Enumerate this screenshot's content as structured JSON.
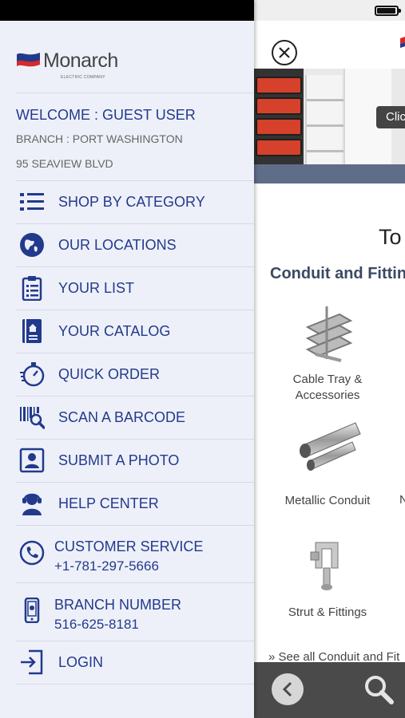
{
  "drawer": {
    "logo_text": "Monarch",
    "logo_subtext": "ELECTRIC COMPANY",
    "welcome": "WELCOME : GUEST USER",
    "branch": "BRANCH : PORT WASHINGTON",
    "address": "95 SEAVIEW BLVD",
    "menu": [
      {
        "label": "SHOP BY CATEGORY",
        "icon": "list-icon"
      },
      {
        "label": "OUR LOCATIONS",
        "icon": "location-globe-icon"
      },
      {
        "label": "YOUR LIST",
        "icon": "clipboard-list-icon"
      },
      {
        "label": "YOUR CATALOG",
        "icon": "catalog-book-icon"
      },
      {
        "label": "QUICK ORDER",
        "icon": "stopwatch-icon"
      },
      {
        "label": "SCAN A BARCODE",
        "icon": "barcode-scan-icon"
      },
      {
        "label": "SUBMIT A PHOTO",
        "icon": "photo-portrait-icon"
      },
      {
        "label": "HELP CENTER",
        "icon": "headset-agent-icon"
      },
      {
        "label": "CUSTOMER SERVICE",
        "sub": "+1-781-297-5666",
        "icon": "phone-icon"
      },
      {
        "label": "BRANCH NUMBER",
        "sub": "516-625-8181",
        "icon": "mobile-phone-icon"
      },
      {
        "label": "LOGIN",
        "icon": "login-arrow-icon"
      }
    ]
  },
  "app": {
    "banner_button": "Click",
    "section_title": "To",
    "section_subtitle": "Conduit and Fittin",
    "products": [
      {
        "name": "Cable Tray &\nAccessories"
      },
      {
        "name": "Metallic Conduit"
      },
      {
        "name": "Strut & Fittings"
      }
    ],
    "product_fragment": "N",
    "see_all": "» See all Conduit and Fit"
  },
  "colors": {
    "drawer_bg": "#eef0f9",
    "menu_text": "#223a8c",
    "bottom_bar": "#4a4a4a",
    "brand_red": "#d62b2b",
    "brand_blue": "#223a8c"
  }
}
